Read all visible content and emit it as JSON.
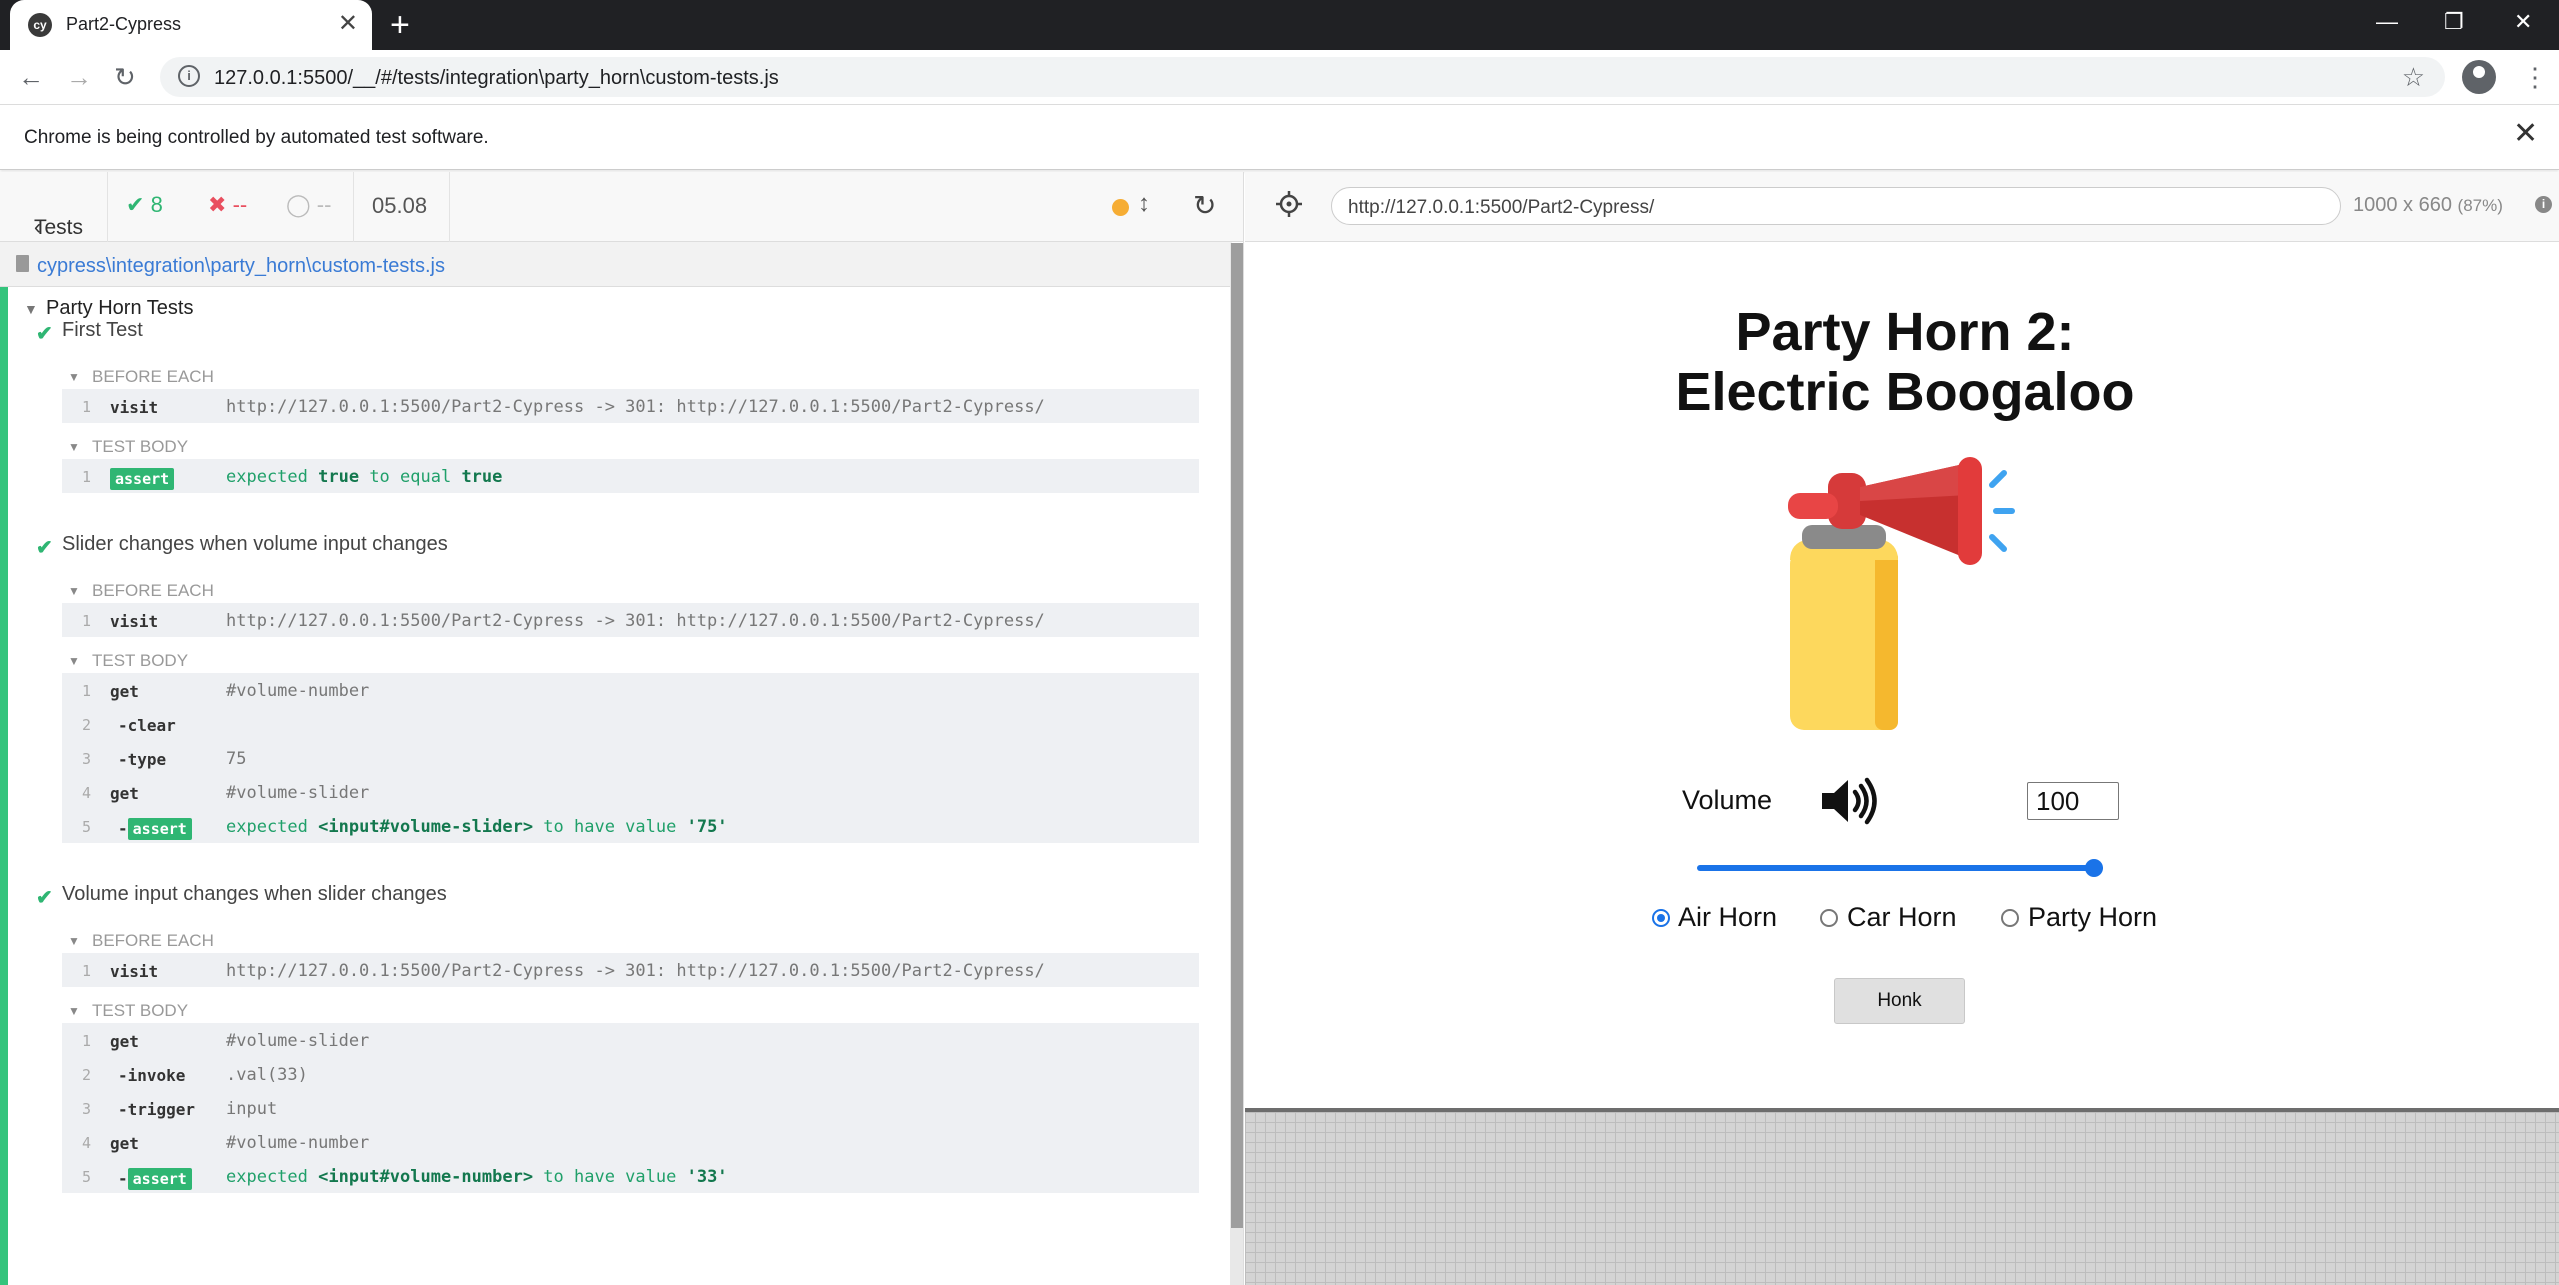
{
  "browser": {
    "tab_title": "Part2-Cypress",
    "favicon_text": "cy",
    "url": "127.0.0.1:5500/__/#/tests/integration\\party_horn\\custom-tests.js",
    "infobar_text": "Chrome is being controlled by automated test software."
  },
  "reporter": {
    "tests_label": "Tests",
    "passed": "8",
    "failed": "--",
    "pending": "--",
    "duration": "05.08",
    "spec_path": "cypress\\integration\\party_horn\\custom-tests.js",
    "suite_title": "Party Horn Tests",
    "before_each_label": "BEFORE EACH",
    "test_body_label": "TEST BODY",
    "tests": [
      {
        "title": "First Test",
        "before_each": [
          {
            "num": "1",
            "name": "visit",
            "msg": "http://127.0.0.1:5500/Part2-Cypress -> 301: http://127.0.0.1:5500/Part2-Cypress/"
          }
        ],
        "body": [
          {
            "num": "1",
            "name": "assert",
            "parts": [
              "expected ",
              "true",
              " to equal ",
              "true"
            ]
          }
        ]
      },
      {
        "title": "Slider changes when volume input changes",
        "before_each": [
          {
            "num": "1",
            "name": "visit",
            "msg": "http://127.0.0.1:5500/Part2-Cypress -> 301: http://127.0.0.1:5500/Part2-Cypress/"
          }
        ],
        "body": [
          {
            "num": "1",
            "name": "get",
            "msg": "#volume-number"
          },
          {
            "num": "2",
            "name": "-clear",
            "msg": ""
          },
          {
            "num": "3",
            "name": "-type",
            "msg": "75"
          },
          {
            "num": "4",
            "name": "get",
            "msg": "#volume-slider"
          },
          {
            "num": "5",
            "name": "-assert",
            "parts": [
              "expected ",
              "<input#volume-slider>",
              " to have value ",
              "'75'"
            ]
          }
        ]
      },
      {
        "title": "Volume input changes when slider changes",
        "before_each": [
          {
            "num": "1",
            "name": "visit",
            "msg": "http://127.0.0.1:5500/Part2-Cypress -> 301: http://127.0.0.1:5500/Part2-Cypress/"
          }
        ],
        "body": [
          {
            "num": "1",
            "name": "get",
            "msg": "#volume-slider"
          },
          {
            "num": "2",
            "name": "-invoke",
            "msg": ".val(33)"
          },
          {
            "num": "3",
            "name": "-trigger",
            "msg": "input"
          },
          {
            "num": "4",
            "name": "get",
            "msg": "#volume-number"
          },
          {
            "num": "5",
            "name": "-assert",
            "parts": [
              "expected ",
              "<input#volume-number>",
              " to have value ",
              "'33'"
            ]
          }
        ]
      }
    ]
  },
  "aut": {
    "url": "http://127.0.0.1:5500/Part2-Cypress/",
    "viewport": "1000 x 660",
    "zoom": "(87%)",
    "title_line1": "Party Horn 2:",
    "title_line2": "Electric Boogaloo",
    "volume_label": "Volume",
    "volume_value": "100",
    "slider_fraction": 1.0,
    "radio_options": [
      {
        "label": "Air Horn",
        "checked": true
      },
      {
        "label": "Car Horn",
        "checked": false
      },
      {
        "label": "Party Horn",
        "checked": false
      }
    ],
    "honk_label": "Honk"
  },
  "colors": {
    "pass": "#2fb673",
    "fail": "#e94f5f",
    "running": "#f6ad34",
    "link": "#3a7bd5"
  }
}
